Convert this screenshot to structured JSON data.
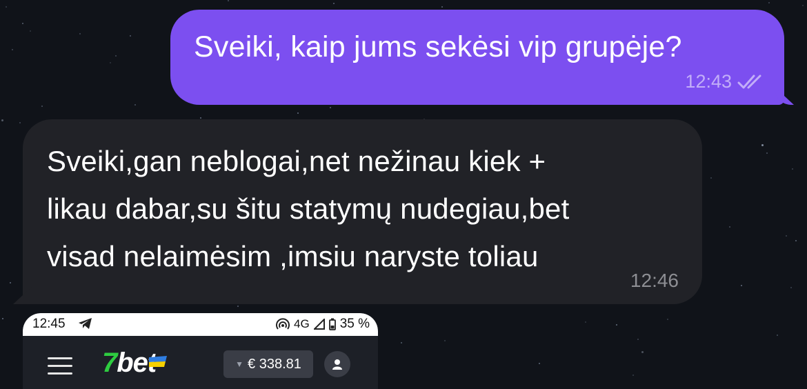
{
  "messages": [
    {
      "direction": "outgoing",
      "text": "Sveiki, kaip jums sekėsi vip grupėje?",
      "time": "12:43",
      "status_icon": "double-check-icon",
      "color": "#7c4ff0"
    },
    {
      "direction": "incoming",
      "lines": [
        "Sveiki,gan neblogai,net nežinau kiek +",
        "likau dabar,su šitu statymų nudegiau,bet",
        "visad nelaimėsim ,imsiu naryste toliau"
      ],
      "time": "12:46",
      "color": "#212227"
    }
  ],
  "attached_screenshot": {
    "statusbar": {
      "time": "12:45",
      "app_icon": "telegram-icon",
      "hotspot_icon": "hotspot-icon",
      "network": "4G",
      "signal_icon": "signal-icon",
      "battery_icon": "battery-icon",
      "battery": "35 %"
    },
    "app": {
      "menu_icon": "hamburger-menu-icon",
      "logo_seven": "7",
      "logo_bet": "bet",
      "balance_icon": "caret-down-icon",
      "balance": "€ 338.81",
      "profile_icon": "user-icon",
      "brand_color": "#2ecc40"
    }
  }
}
